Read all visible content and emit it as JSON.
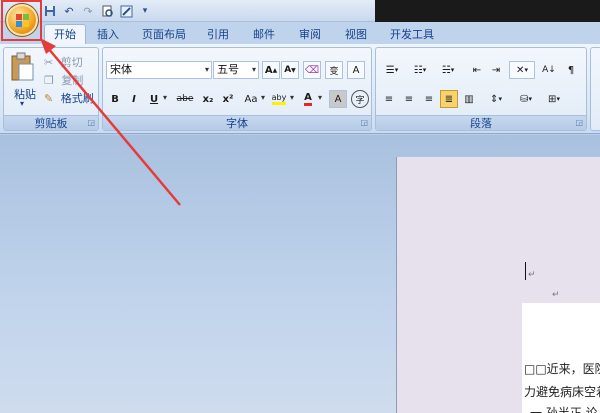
{
  "quick_access": {
    "save_icon": "save-icon",
    "undo_icon": "undo-icon",
    "redo_icon": "redo-icon",
    "print_preview_icon": "print-preview-icon",
    "customize_icon": "customize-icon"
  },
  "tabs": [
    {
      "label": "开始",
      "active": true
    },
    {
      "label": "插入"
    },
    {
      "label": "页面布局"
    },
    {
      "label": "引用"
    },
    {
      "label": "邮件"
    },
    {
      "label": "审阅"
    },
    {
      "label": "视图"
    },
    {
      "label": "开发工具"
    }
  ],
  "clipboard": {
    "title": "剪贴板",
    "paste": "粘贴",
    "cut": "剪切",
    "copy": "复制",
    "format_painter": "格式刷"
  },
  "font": {
    "title": "字体",
    "font_name": "宋体",
    "font_size": "五号",
    "grow": "A",
    "shrink": "A",
    "bold": "B",
    "italic": "I",
    "underline": "U",
    "strike": "abe",
    "subscript": "x₂",
    "superscript": "x²",
    "change_case": "Aa",
    "font_color": "A",
    "char_shading": "A",
    "enclose": "字",
    "phonetic": "变",
    "char_border": "A",
    "highlight": "aby"
  },
  "paragraph": {
    "title": "段落"
  },
  "document": {
    "line1": "□□近来，医院",
    "line2": "力避免病床空着",
    "line3": "一 孙半正 论"
  },
  "colors": {
    "accent": "#15428b",
    "highlight_box": "#e53b3b"
  }
}
